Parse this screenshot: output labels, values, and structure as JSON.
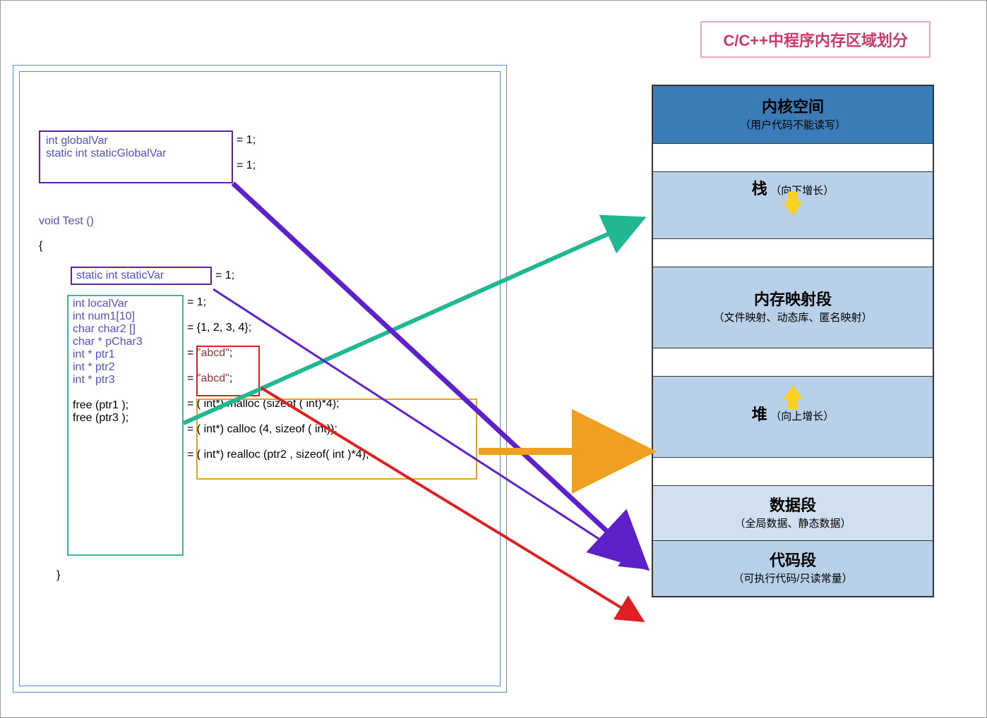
{
  "title": "C/C++中程序内存区域划分",
  "code": {
    "global_var": "int globalVar",
    "global_val": "= 1;",
    "static_global": "static int staticGlobalVar",
    "static_global_val": "= 1;",
    "fn_decl": "void Test ()",
    "brace_open": "{",
    "static_var": "static int staticVar",
    "static_var_val": "= 1;",
    "local_var": "int localVar",
    "local_val": "= 1;",
    "num1": "int num1[10]",
    "num1_val": "= {1, 2, 3, 4};",
    "char2": "char char2 []",
    "char2_val": "= \"abcd\";",
    "pchar3": "char * pChar3",
    "pchar3_val": "= \"abcd\";",
    "ptr1": "int * ptr1",
    "ptr1_val": "= ( int*) malloc (sizeof ( int)*4);",
    "ptr2": "int * ptr2",
    "ptr2_val": "= ( int*) calloc (4, sizeof ( int));",
    "ptr3": "int * ptr3",
    "ptr3_val": "= ( int*) realloc (ptr2 , sizeof( int )*4);",
    "free1": "free (ptr1 );",
    "free3": "free (ptr3 );",
    "brace_close": "}"
  },
  "memory": {
    "kernel_title": "内核空间",
    "kernel_sub": "（用户代码不能读写）",
    "stack_title": "栈",
    "stack_sub": "（向下增长）",
    "map_title": "内存映射段",
    "map_sub": "（文件映射、动态库、匿名映射）",
    "heap_title": "堆",
    "heap_sub": "（向上增长）",
    "data_title": "数据段",
    "data_sub": "（全局数据、静态数据）",
    "code_title": "代码段",
    "code_sub": "（可执行代码/只读常量）"
  }
}
